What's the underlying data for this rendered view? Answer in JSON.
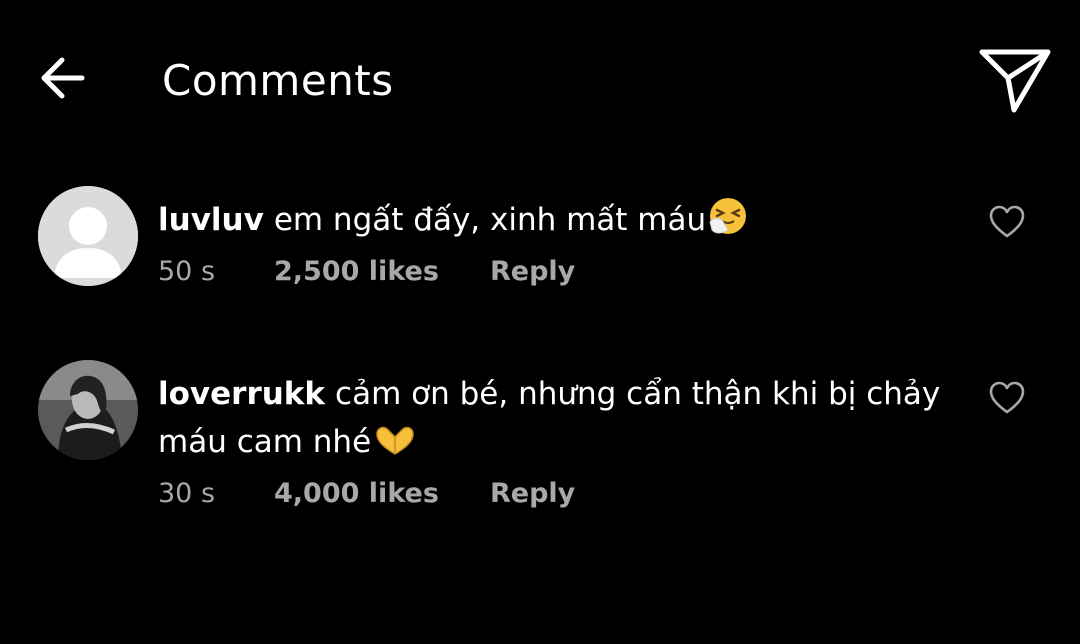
{
  "header": {
    "title": "Comments",
    "back_icon": "arrow-left-icon",
    "send_icon": "send-paper-plane-icon"
  },
  "comments": [
    {
      "username": "luvluv",
      "text": "em ngất đấy, xinh mất máu",
      "emoji": "sneezing-face-emoji",
      "time": "50 s",
      "likes": "2,500 likes",
      "reply_label": "Reply",
      "avatar": "default-avatar"
    },
    {
      "username": "loverrukk",
      "text": "cảm ơn bé, nhưng cẩn thận khi bị chảy máu cam nhé",
      "emoji": "heart-hands-emoji",
      "time": "30 s",
      "likes": "4,000 likes",
      "reply_label": "Reply",
      "avatar": "profile-photo"
    }
  ],
  "colors": {
    "background": "#000000",
    "text": "#ffffff",
    "secondary_text": "#a8a8a8",
    "icon": "#ffffff",
    "heart_outline": "#a8a8a8",
    "default_avatar": "#dbdbdb"
  }
}
